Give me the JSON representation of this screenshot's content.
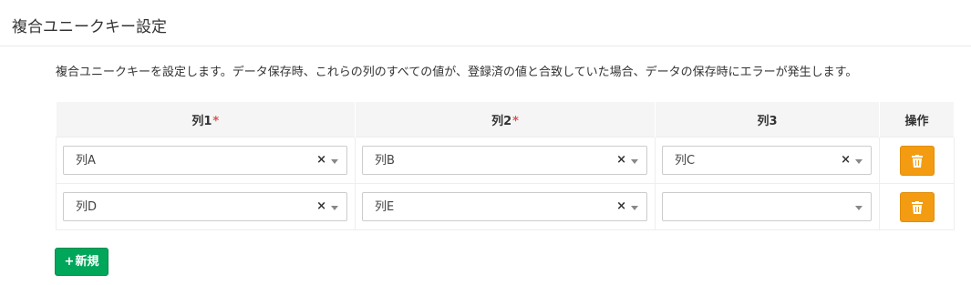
{
  "header": {
    "title": "複合ユニークキー設定"
  },
  "description": "複合ユニークキーを設定します。データ保存時、これらの列のすべての値が、登録済の値と合致していた場合、データの保存時にエラーが発生します。",
  "table": {
    "columns": [
      {
        "label": "列1",
        "required_mark": "*"
      },
      {
        "label": "列2",
        "required_mark": "*"
      },
      {
        "label": "列3"
      },
      {
        "label": "操作"
      }
    ],
    "clear_symbol": "×",
    "rows": [
      {
        "col1": "列A",
        "col2": "列B",
        "col3": "列C"
      },
      {
        "col1": "列D",
        "col2": "列E",
        "col3": ""
      }
    ],
    "delete_icon": "trash-icon"
  },
  "new_button": {
    "icon": "plus-icon",
    "plus_symbol": "+",
    "label": "新規"
  },
  "colors": {
    "delete": "#f39c12",
    "new": "#00a65a",
    "required": "#d9534f"
  }
}
